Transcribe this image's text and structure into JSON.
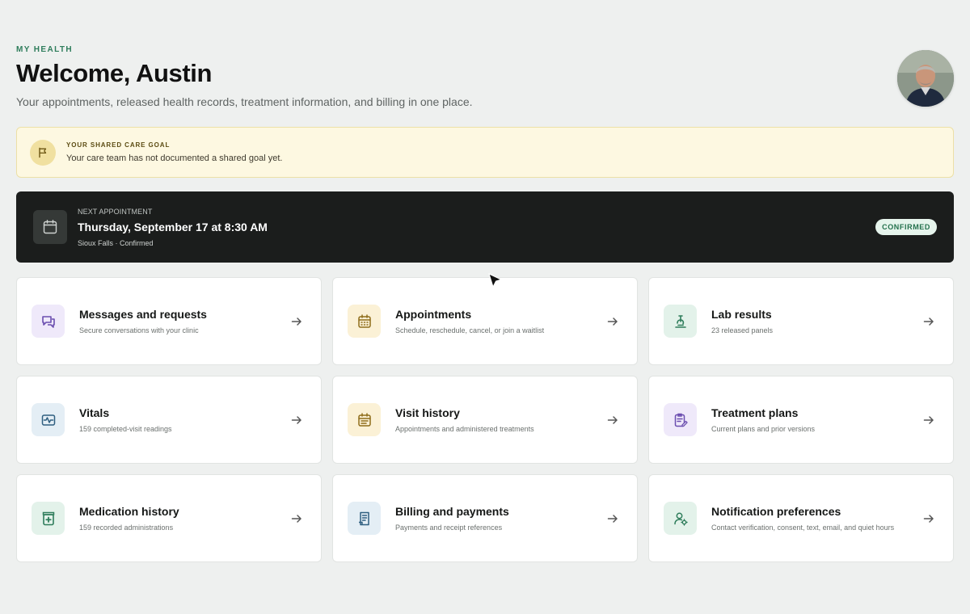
{
  "header": {
    "eyebrow": "MY HEALTH",
    "title": "Welcome, Austin",
    "subtitle": "Your appointments, released health records, treatment information, and billing in one place."
  },
  "avatar": {
    "icon": "user-avatar-photo"
  },
  "goal": {
    "icon": "flag-icon",
    "title": "YOUR SHARED CARE GOAL",
    "text": "Your care team has not documented a shared goal yet."
  },
  "appointment": {
    "icon": "calendar-icon",
    "label": "NEXT APPOINTMENT",
    "title": "Thursday, September 17 at 8:30 AM",
    "sub": "Sioux Falls · Confirmed",
    "badge": "CONFIRMED"
  },
  "cards": [
    {
      "title": "Messages and requests",
      "desc": "Secure conversations with your clinic",
      "icon": "chat-icon",
      "bg": "#efe9fa",
      "fg": "#6c4fb0"
    },
    {
      "title": "Appointments",
      "desc": "Schedule, reschedule, cancel, or join a waitlist",
      "icon": "calendar-grid-icon",
      "bg": "#fbf1d6",
      "fg": "#8f6d1a"
    },
    {
      "title": "Lab results",
      "desc": "23 released panels",
      "icon": "microscope-icon",
      "bg": "#e3f2ea",
      "fg": "#2e7d5b"
    },
    {
      "title": "Vitals",
      "desc": "159 completed-visit readings",
      "icon": "pulse-icon",
      "bg": "#e4eef5",
      "fg": "#2f5f80"
    },
    {
      "title": "Visit history",
      "desc": "Appointments and administered treatments",
      "icon": "calendar-list-icon",
      "bg": "#fbf1d6",
      "fg": "#8f6d1a"
    },
    {
      "title": "Treatment plans",
      "desc": "Current plans and prior versions",
      "icon": "clipboard-edit-icon",
      "bg": "#efe9fa",
      "fg": "#6c4fb0"
    },
    {
      "title": "Medication history",
      "desc": "159 recorded administrations",
      "icon": "medicine-bottle-icon",
      "bg": "#e3f2ea",
      "fg": "#2e7d5b"
    },
    {
      "title": "Billing and payments",
      "desc": "Payments and receipt references",
      "icon": "receipt-icon",
      "bg": "#e4eef5",
      "fg": "#2f5f80"
    },
    {
      "title": "Notification preferences",
      "desc": "Contact verification, consent, text, email, and quiet hours",
      "icon": "user-settings-icon",
      "bg": "#e3f2ea",
      "fg": "#2e7d5b"
    }
  ],
  "colors": {
    "accent": "#2e7d5b",
    "appointment_bg": "#1b1d1c",
    "goal_bg": "#fdf8e1"
  }
}
